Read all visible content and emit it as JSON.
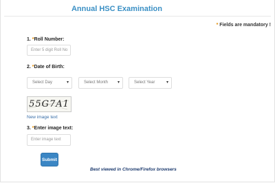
{
  "header": {
    "title": "Annual HSC Examination"
  },
  "form": {
    "mandatory_note": {
      "star": "*",
      "text": " Fields are mandatory !"
    },
    "roll_number": {
      "label_prefix": "1. ",
      "star": "*",
      "label_text": "Roll Number:",
      "placeholder": "Enter 5 digit Roll No"
    },
    "date_of_birth": {
      "label_prefix": "2. ",
      "star": "*",
      "label_text": "Date of Birth:",
      "day": "Select Day",
      "month": "Select Month",
      "year": "Select Year"
    },
    "captcha": {
      "image_text": "55G7A1",
      "new_image_link": "New image text"
    },
    "image_text": {
      "label_prefix": "3. ",
      "star": "*",
      "label_text": "Enter image text:",
      "placeholder": "Enter image text"
    },
    "submit_label": "Submit"
  },
  "footer": {
    "note": "Best viewed in Chrome/Firefox browsers"
  },
  "icons": {
    "select_chevron": "chevron-down-icon",
    "chevron_glyph": "▾"
  },
  "colors": {
    "title": "#3a8fc4",
    "required_star": "#e08a00",
    "submit_button": "#3b86c4",
    "footer_note": "#1c3a6e"
  }
}
